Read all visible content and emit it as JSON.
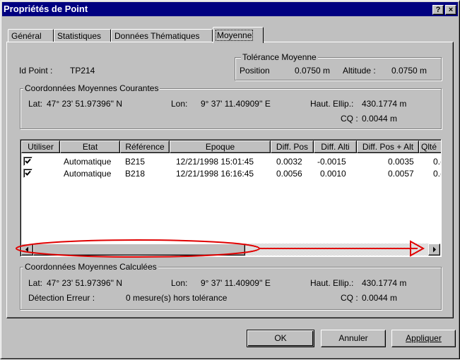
{
  "window": {
    "title": "Propriétés de Point",
    "help_button": "?",
    "close_button": "×"
  },
  "tabs": [
    {
      "label": "Général"
    },
    {
      "label": "Statistiques"
    },
    {
      "label": "Données Thématiques"
    },
    {
      "label": "Moyenne",
      "active": true
    }
  ],
  "point": {
    "id_label": "Id Point :",
    "id_value": "TP214"
  },
  "tolerance": {
    "legend": "Tolérance Moyenne",
    "position_label": "Position",
    "position_value": "0.0750 m",
    "altitude_label": "Altitude :",
    "altitude_value": "0.0750 m"
  },
  "current": {
    "legend": "Coordonnées Moyennes Courantes",
    "lat_label": "Lat:",
    "lat_value": "47° 23' 51.97396'' N",
    "lon_label": "Lon:",
    "lon_value": "9° 37' 11.40909'' E",
    "haut_label": "Haut. Ellip.:",
    "haut_value": "430.1774 m",
    "cq_label": "CQ :",
    "cq_value": "0.0044 m"
  },
  "table": {
    "columns": [
      "Utiliser",
      "Etat",
      "Référence",
      "Epoque",
      "Diff. Pos",
      "Diff. Alti",
      "Diff. Pos + Alt",
      "Qlté"
    ],
    "rows": [
      {
        "use": true,
        "etat": "Automatique",
        "reference": "B215",
        "epoque": "12/21/1998 15:01:45",
        "diff_pos": "0.0032",
        "diff_alti": "-0.0015",
        "diff_pos_alt": "0.0035",
        "qlte": "0.("
      },
      {
        "use": true,
        "etat": "Automatique",
        "reference": "B218",
        "epoque": "12/21/1998 16:16:45",
        "diff_pos": "0.0056",
        "diff_alti": "0.0010",
        "diff_pos_alt": "0.0057",
        "qlte": "0.("
      }
    ]
  },
  "computed": {
    "legend": "Coordonnées Moyennes Calculées",
    "lat_label": "Lat:",
    "lat_value": "47° 23' 51.97396'' N",
    "lon_label": "Lon:",
    "lon_value": "9° 37' 11.40909'' E",
    "haut_label": "Haut. Ellip.:",
    "haut_value": "430.1774 m",
    "error_label": "Détection Erreur :",
    "error_value": "0 mesure(s) hors tolérance",
    "cq_label": "CQ :",
    "cq_value": "0.0044 m"
  },
  "buttons": {
    "ok": "OK",
    "cancel": "Annuler",
    "apply": "Appliquer"
  },
  "colors": {
    "annotation": "#e00000",
    "titlebar": "#000080"
  }
}
